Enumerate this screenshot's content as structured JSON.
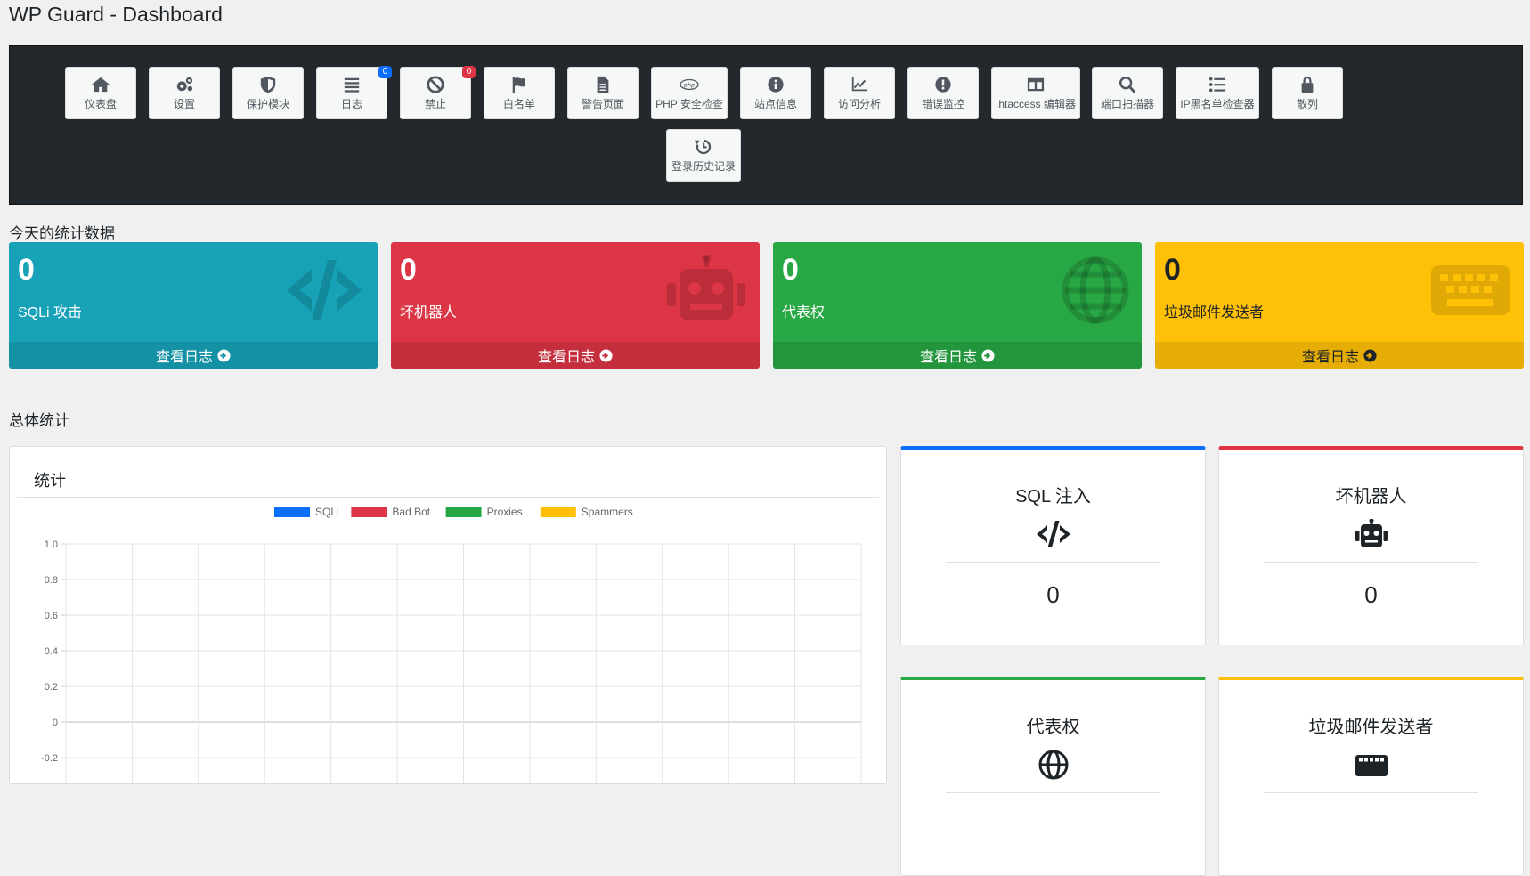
{
  "page": {
    "title": "WP Guard - Dashboard"
  },
  "toolbar": {
    "row1": [
      {
        "label": "仪表盘",
        "icon": "home-icon"
      },
      {
        "label": "设置",
        "icon": "gears-icon"
      },
      {
        "label": "保护模块",
        "icon": "shield-icon"
      },
      {
        "label": "日志",
        "icon": "list-icon",
        "badge": "0",
        "badge_color": "#0d6efd"
      },
      {
        "label": "禁止",
        "icon": "ban-icon",
        "badge": "0",
        "badge_color": "#dc3545"
      },
      {
        "label": "白名单",
        "icon": "flag-icon"
      },
      {
        "label": "警告页面",
        "icon": "file-icon"
      },
      {
        "label": "PHP 安全检查",
        "icon": "php-icon"
      },
      {
        "label": "站点信息",
        "icon": "info-icon"
      },
      {
        "label": "访问分析",
        "icon": "chart-line-icon"
      },
      {
        "label": "错误监控",
        "icon": "exclamation-icon"
      },
      {
        "label": ".htaccess 编辑器",
        "icon": "columns-icon"
      },
      {
        "label": "端口扫描器",
        "icon": "search-icon"
      },
      {
        "label": "IP黑名单检查器",
        "icon": "list-ul-icon"
      },
      {
        "label": "散列",
        "icon": "lock-icon"
      }
    ],
    "row2": [
      {
        "label": "登录历史记录",
        "icon": "history-icon"
      }
    ]
  },
  "today": {
    "title": "今天的统计数据",
    "cards": [
      {
        "value": "0",
        "label": "SQLi 攻击",
        "link": "查看日志",
        "color": "#17a2b8",
        "icon": "code-icon"
      },
      {
        "value": "0",
        "label": "坏机器人",
        "link": "查看日志",
        "color": "#dc3545",
        "icon": "robot-icon"
      },
      {
        "value": "0",
        "label": "代表权",
        "link": "查看日志",
        "color": "#28a745",
        "icon": "globe-icon"
      },
      {
        "value": "0",
        "label": "垃圾邮件发送者",
        "link": "查看日志",
        "color": "#ffc107",
        "icon": "keyboard-icon"
      }
    ]
  },
  "overall": {
    "title": "总体统计",
    "chart_panel_title": "统计",
    "boxes": [
      {
        "title": "SQL 注入",
        "value": "0",
        "color": "#0d6efd",
        "icon": "code-icon"
      },
      {
        "title": "坏机器人",
        "value": "0",
        "color": "#dc3545",
        "icon": "robot-icon"
      },
      {
        "title": "代表权",
        "value": "",
        "color": "#28a745",
        "icon": "globe-icon"
      },
      {
        "title": "垃圾邮件发送者",
        "value": "",
        "color": "#ffc107",
        "icon": "keyboard-icon"
      }
    ]
  },
  "chart_data": {
    "type": "line",
    "series": [
      {
        "name": "SQLi",
        "color": "#0d6efd",
        "values": []
      },
      {
        "name": "Bad Bot",
        "color": "#dc3545",
        "values": []
      },
      {
        "name": "Proxies",
        "color": "#28a745",
        "values": []
      },
      {
        "name": "Spammers",
        "color": "#ffc107",
        "values": []
      }
    ],
    "y_ticks": [
      "1.0",
      "0.8",
      "0.6",
      "0.4",
      "0.2",
      "0",
      "-0.2"
    ],
    "ylim": [
      -0.2,
      1.0
    ],
    "grid": true,
    "legend": "top-center",
    "title": "",
    "xlabel": "",
    "ylabel": ""
  }
}
